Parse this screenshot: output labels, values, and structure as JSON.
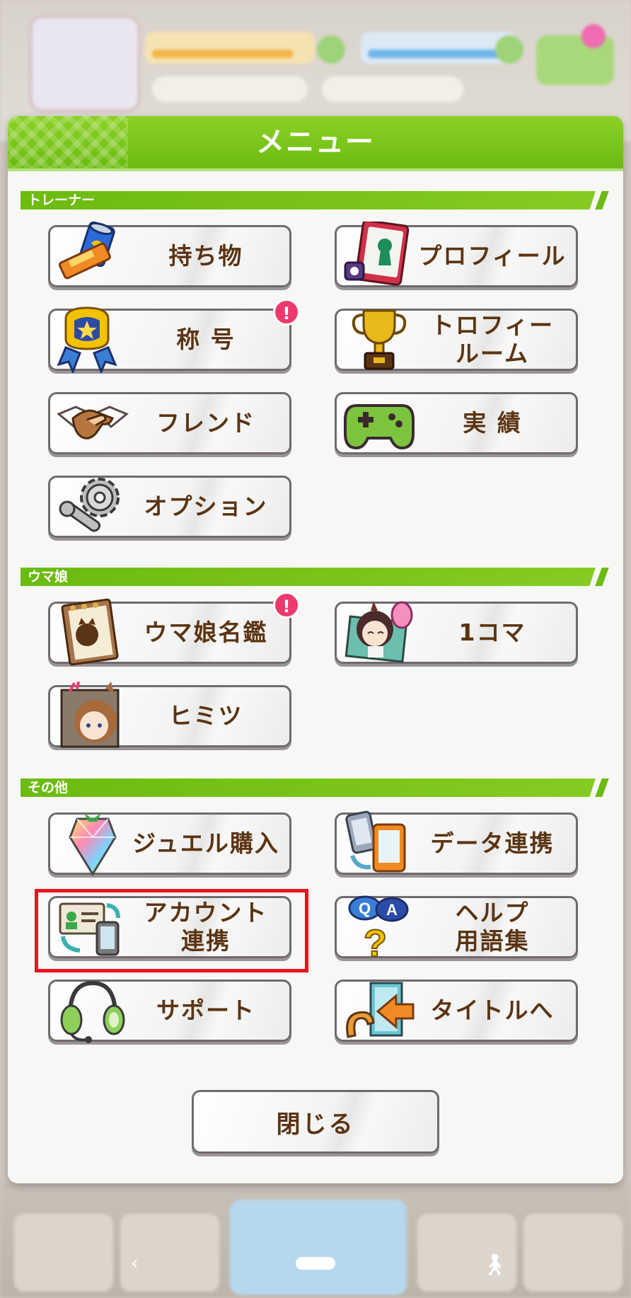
{
  "colors": {
    "header_green": "#6cbb10",
    "label_brown": "#5b3412",
    "notification_pink": "#ec3a6e",
    "highlight_red": "#e8141e"
  },
  "dialog": {
    "title": "メニュー",
    "close_label": "閉じる"
  },
  "sections": {
    "trainer": {
      "label": "トレーナー",
      "items": [
        {
          "label": "持ち物",
          "icon": "items-can-icon"
        },
        {
          "label": "プロフィール",
          "icon": "profile-card-icon"
        },
        {
          "label": "称 号",
          "icon": "title-horseshoe-icon",
          "notification": "!"
        },
        {
          "label": "トロフィー\nルーム",
          "icon": "trophy-icon"
        },
        {
          "label": "フレンド",
          "icon": "handshake-icon"
        },
        {
          "label": "実 績",
          "icon": "gamepad-icon"
        },
        {
          "label": "オプション",
          "icon": "gear-wrench-icon"
        }
      ]
    },
    "umamusume": {
      "label": "ウマ娘",
      "items": [
        {
          "label": "ウマ娘名鑑",
          "icon": "notebook-icon",
          "notification": "!"
        },
        {
          "label": "1コマ",
          "icon": "character-photo-icon"
        },
        {
          "label": "ヒミツ",
          "icon": "secret-character-icon"
        }
      ]
    },
    "other": {
      "label": "その他",
      "items": [
        {
          "label": "ジュエル購入",
          "icon": "jewel-icon"
        },
        {
          "label": "データ連携",
          "icon": "data-transfer-icon"
        },
        {
          "label": "アカウント\n連携",
          "icon": "account-link-icon"
        },
        {
          "label": "ヘルプ\n用語集",
          "icon": "help-qa-icon"
        },
        {
          "label": "サポート",
          "icon": "headset-icon"
        },
        {
          "label": "タイトルへ",
          "icon": "exit-door-icon"
        }
      ]
    }
  }
}
